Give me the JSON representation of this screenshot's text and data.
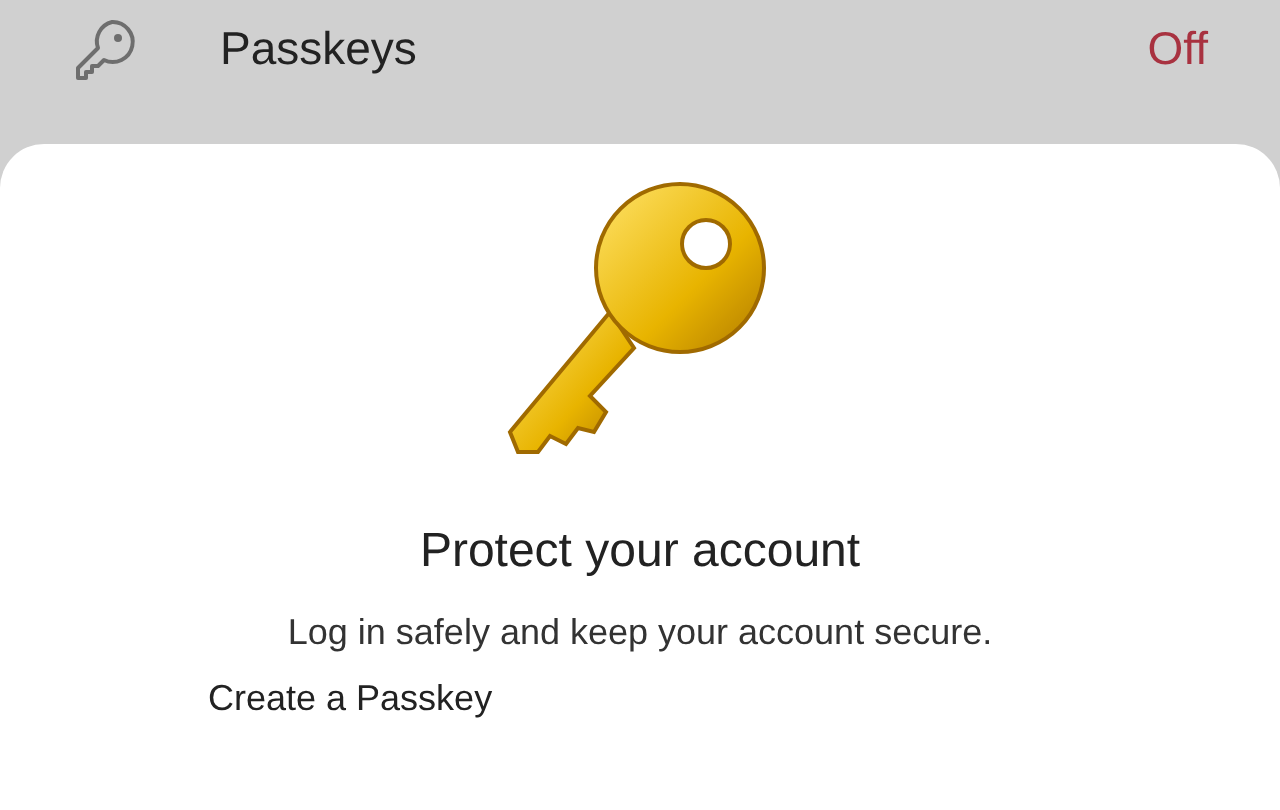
{
  "settings_row": {
    "label": "Passkeys",
    "status": "Off"
  },
  "sheet": {
    "title": "Protect your account",
    "subtitle": "Log in safely and keep your account secure.",
    "options": [
      {
        "label": "Create a Passkey"
      }
    ]
  }
}
